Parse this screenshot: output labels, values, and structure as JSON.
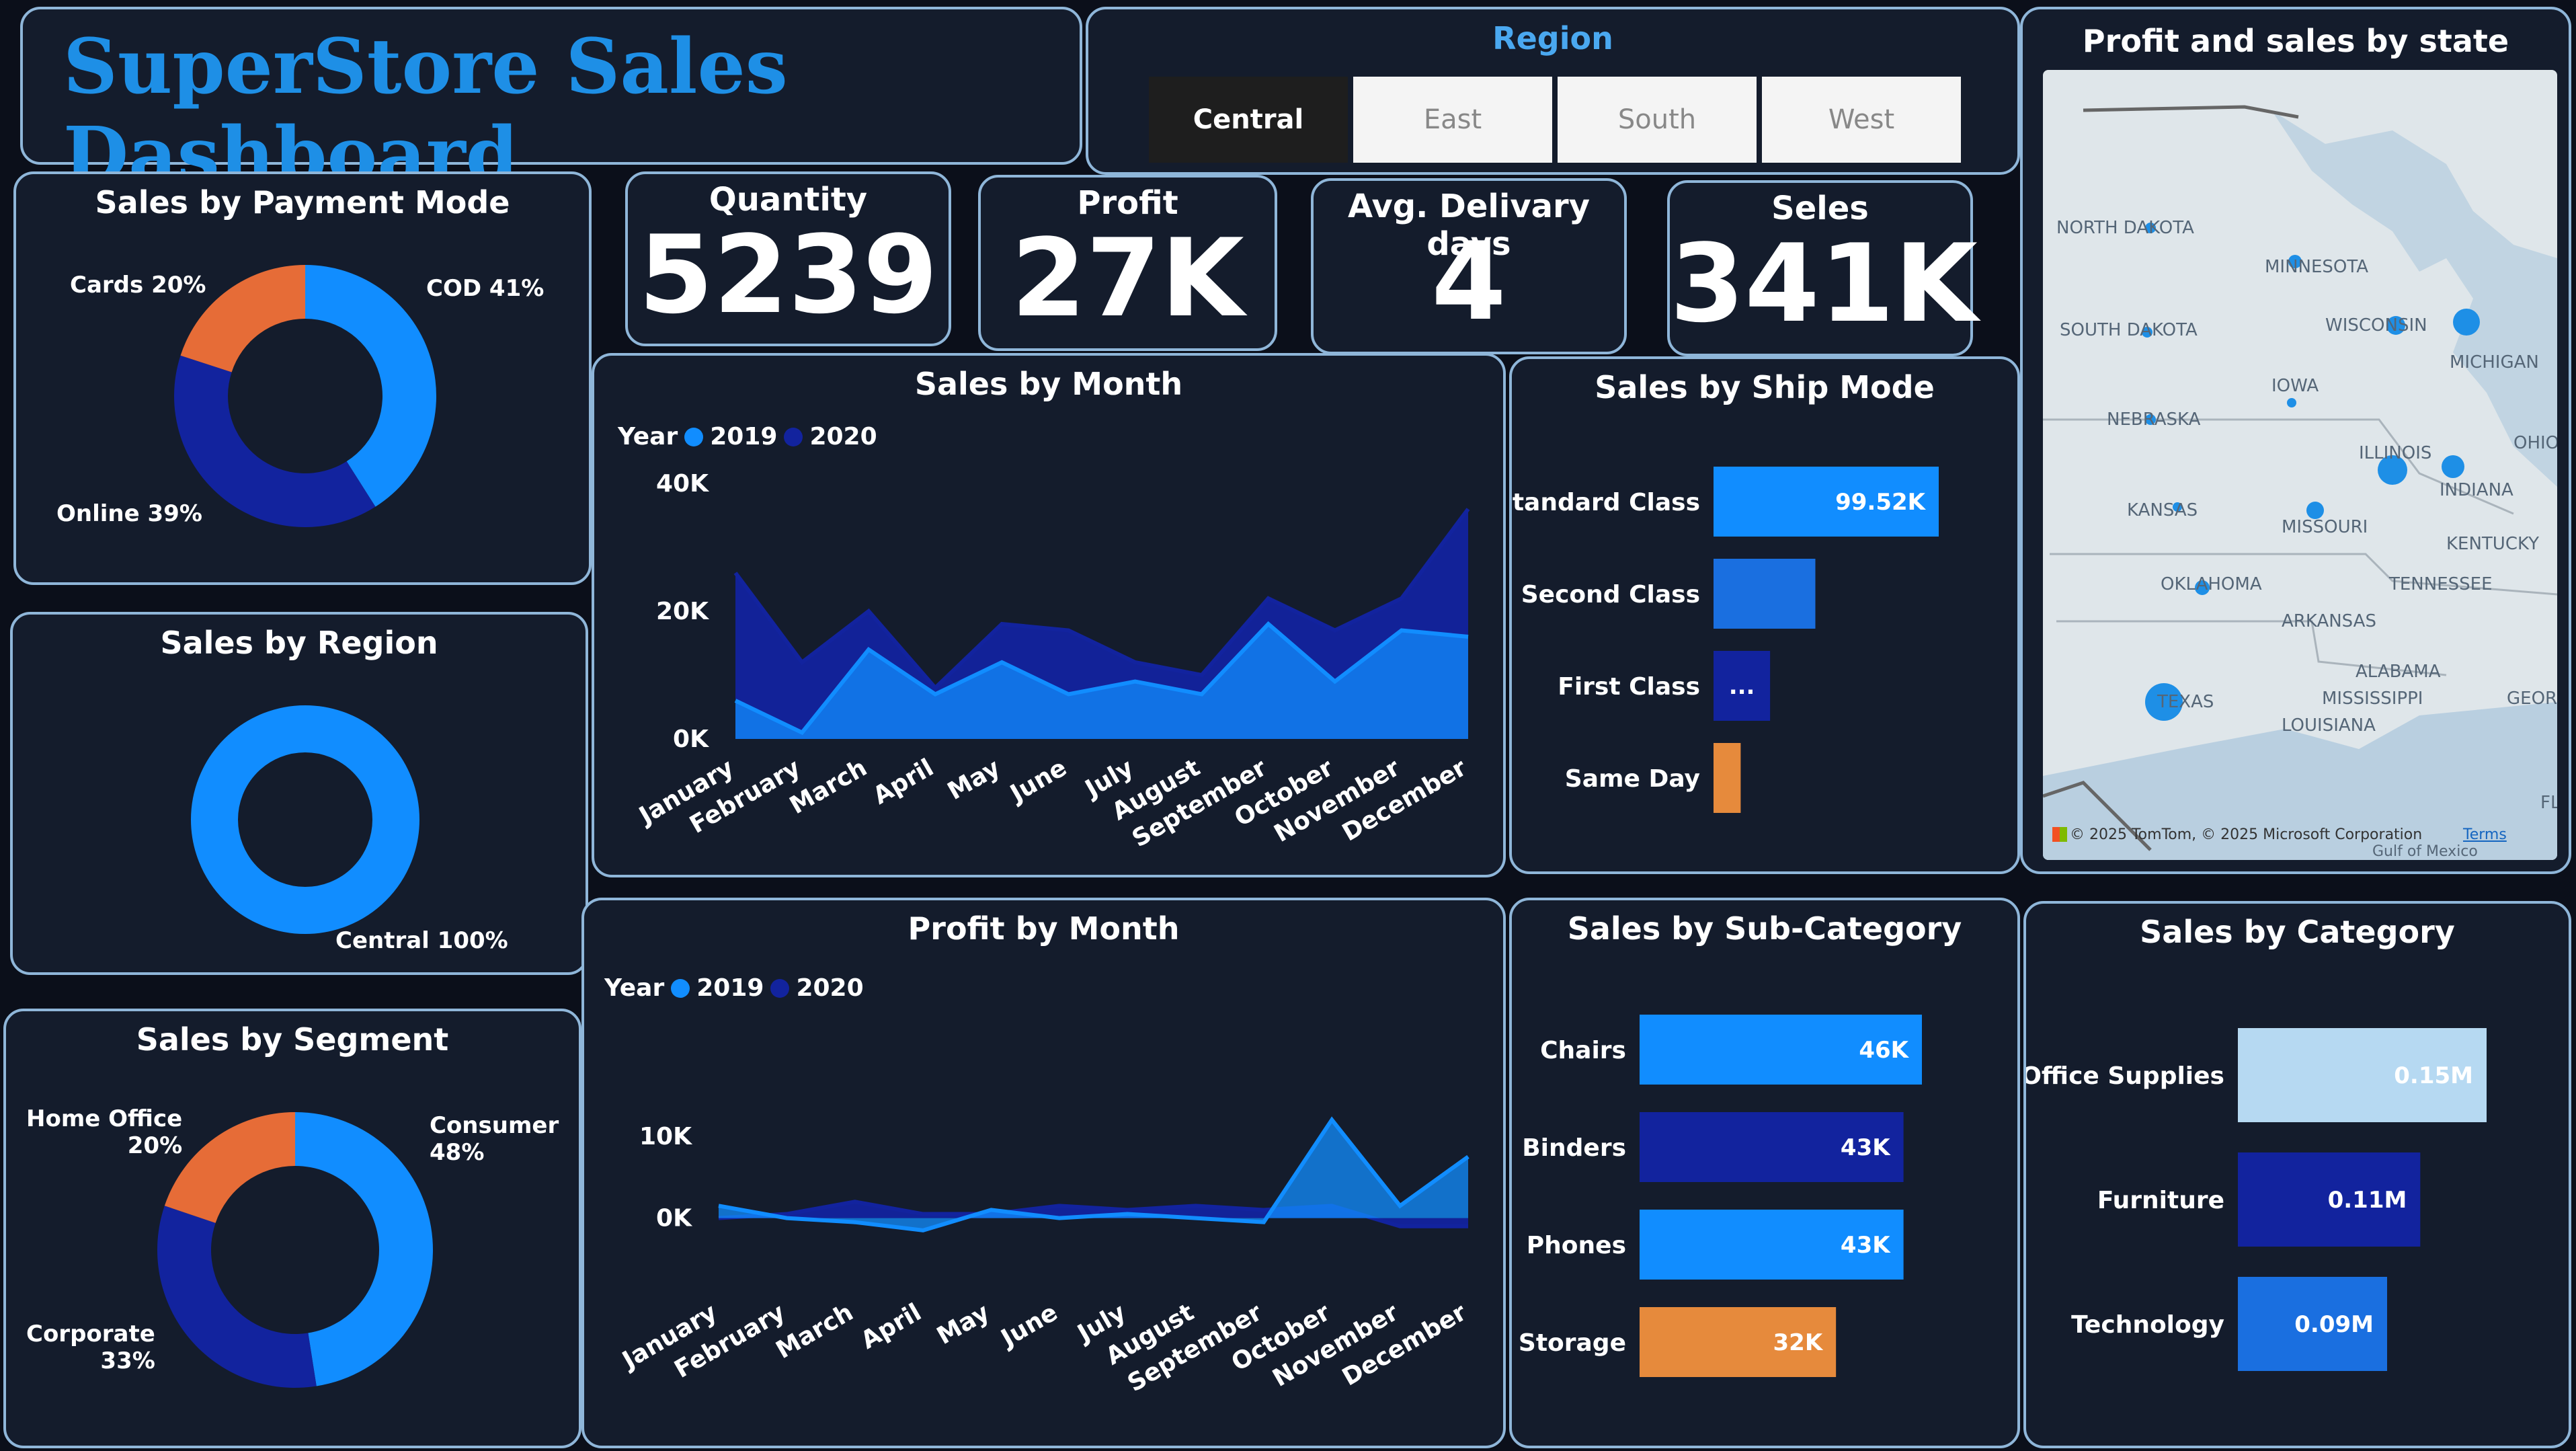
{
  "title": "SuperStore Sales Dashboard",
  "region_slicer": {
    "title": "Region",
    "options": [
      "Central",
      "East",
      "South",
      "West"
    ],
    "selected": "Central"
  },
  "kpis": {
    "quantity": {
      "label": "Quantity",
      "value": "5239"
    },
    "profit": {
      "label": "Profit",
      "value": "27K"
    },
    "delivery": {
      "label": "Avg. Delivary days",
      "value": "4"
    },
    "sales": {
      "label": "Seles",
      "value": "341K"
    }
  },
  "colors": {
    "light_blue": "#118dff",
    "dark_blue": "#12239e",
    "orange": "#e66c37",
    "pale_blue": "#b6d9f2",
    "panel": "#141c2c",
    "border": "#8fb6d9"
  },
  "map": {
    "title": "Profit and sales by state",
    "labels": [
      "NORTH DAKOTA",
      "MINNESOTA",
      "SOUTH DAKOTA",
      "WISCONSIN",
      "MICHIGAN",
      "IOWA",
      "NEBRASKA",
      "ILLINOIS",
      "OHIO",
      "INDIANA",
      "KANSAS",
      "MISSOURI",
      "KENTUCKY",
      "OKLAHOMA",
      "TENNESSEE",
      "ARKANSAS",
      "ALABAMA",
      "MISSISSIPPI",
      "GEORGIA",
      "TEXAS",
      "LOUISIANA",
      "FLO",
      "Gulf of Mexico"
    ],
    "attribution": "© 2025 TomTom, © 2025 Microsoft Corporation",
    "terms": "Terms"
  },
  "chart_data": [
    {
      "id": "payment_mode",
      "type": "pie",
      "title": "Sales by Payment Mode",
      "labels": [
        "COD 41%",
        "Online 39%",
        "Cards 20%"
      ],
      "values": [
        41,
        39,
        20
      ],
      "colors": [
        "#118dff",
        "#12239e",
        "#e66c37"
      ]
    },
    {
      "id": "region",
      "type": "pie",
      "title": "Sales by Region",
      "labels": [
        "Central 100%"
      ],
      "values": [
        100
      ],
      "colors": [
        "#118dff"
      ]
    },
    {
      "id": "segment",
      "type": "pie",
      "title": "Sales by Segment",
      "labels": [
        "Consumer\n48%",
        "Corporate\n33%",
        "Home Office\n20%"
      ],
      "values": [
        48,
        33,
        20
      ],
      "colors": [
        "#118dff",
        "#12239e",
        "#e66c37"
      ]
    },
    {
      "id": "sales_month",
      "type": "area",
      "title": "Sales by Month",
      "legend_title": "Year",
      "categories": [
        "January",
        "February",
        "March",
        "April",
        "May",
        "June",
        "July",
        "August",
        "September",
        "October",
        "November",
        "December"
      ],
      "series": [
        {
          "name": "2019",
          "color": "#118dff",
          "values": [
            6000,
            1000,
            14000,
            7000,
            12000,
            7000,
            9000,
            7000,
            18000,
            9000,
            17000,
            16000
          ]
        },
        {
          "name": "2020",
          "color": "#12239e",
          "values": [
            26000,
            12000,
            20000,
            8000,
            18000,
            17000,
            12000,
            10000,
            22000,
            17000,
            22000,
            36000
          ]
        }
      ],
      "yticks": [
        "40K",
        "20K",
        "0K"
      ],
      "ylim": [
        0,
        40000
      ]
    },
    {
      "id": "profit_month",
      "type": "area",
      "title": "Profit by Month",
      "legend_title": "Year",
      "categories": [
        "January",
        "February",
        "March",
        "April",
        "May",
        "June",
        "July",
        "August",
        "September",
        "October",
        "November",
        "December"
      ],
      "series": [
        {
          "name": "2019",
          "color": "#118dff",
          "values": [
            1500,
            0,
            -500,
            -1500,
            1000,
            0,
            500,
            0,
            -500,
            12000,
            1500,
            7500
          ]
        },
        {
          "name": "2020",
          "color": "#12239e",
          "values": [
            0,
            500,
            2000,
            500,
            500,
            1500,
            1000,
            1500,
            1000,
            1500,
            -1000,
            -1000
          ]
        }
      ],
      "yticks": [
        "10K",
        "0K"
      ],
      "ylim": [
        -8000,
        15000
      ]
    },
    {
      "id": "ship_mode",
      "type": "bar",
      "title": "Sales by Ship Mode",
      "categories": [
        "Standard Class",
        "Second Class",
        "First Class",
        "Same Day"
      ],
      "values": [
        99520,
        45000,
        25000,
        12000
      ],
      "data_labels": [
        "99.52K",
        "",
        "...",
        ""
      ],
      "colors": [
        "#118dff",
        "#1a6fe0",
        "#12239e",
        "#e68a3c"
      ]
    },
    {
      "id": "sub_category",
      "type": "bar",
      "title": "Sales by Sub-Category",
      "categories": [
        "Chairs",
        "Binders",
        "Phones",
        "Storage"
      ],
      "values": [
        46000,
        43000,
        43000,
        32000
      ],
      "data_labels": [
        "46K",
        "43K",
        "43K",
        "32K"
      ],
      "colors": [
        "#118dff",
        "#12239e",
        "#118dff",
        "#e68a3c"
      ]
    },
    {
      "id": "category",
      "type": "bar",
      "title": "Sales by Category",
      "categories": [
        "Office Supplies",
        "Furniture",
        "Technology"
      ],
      "values": [
        150000,
        110000,
        90000
      ],
      "data_labels": [
        "0.15M",
        "0.11M",
        "0.09M"
      ],
      "colors": [
        "#b6d9f2",
        "#12239e",
        "#1a6fe0"
      ]
    }
  ]
}
